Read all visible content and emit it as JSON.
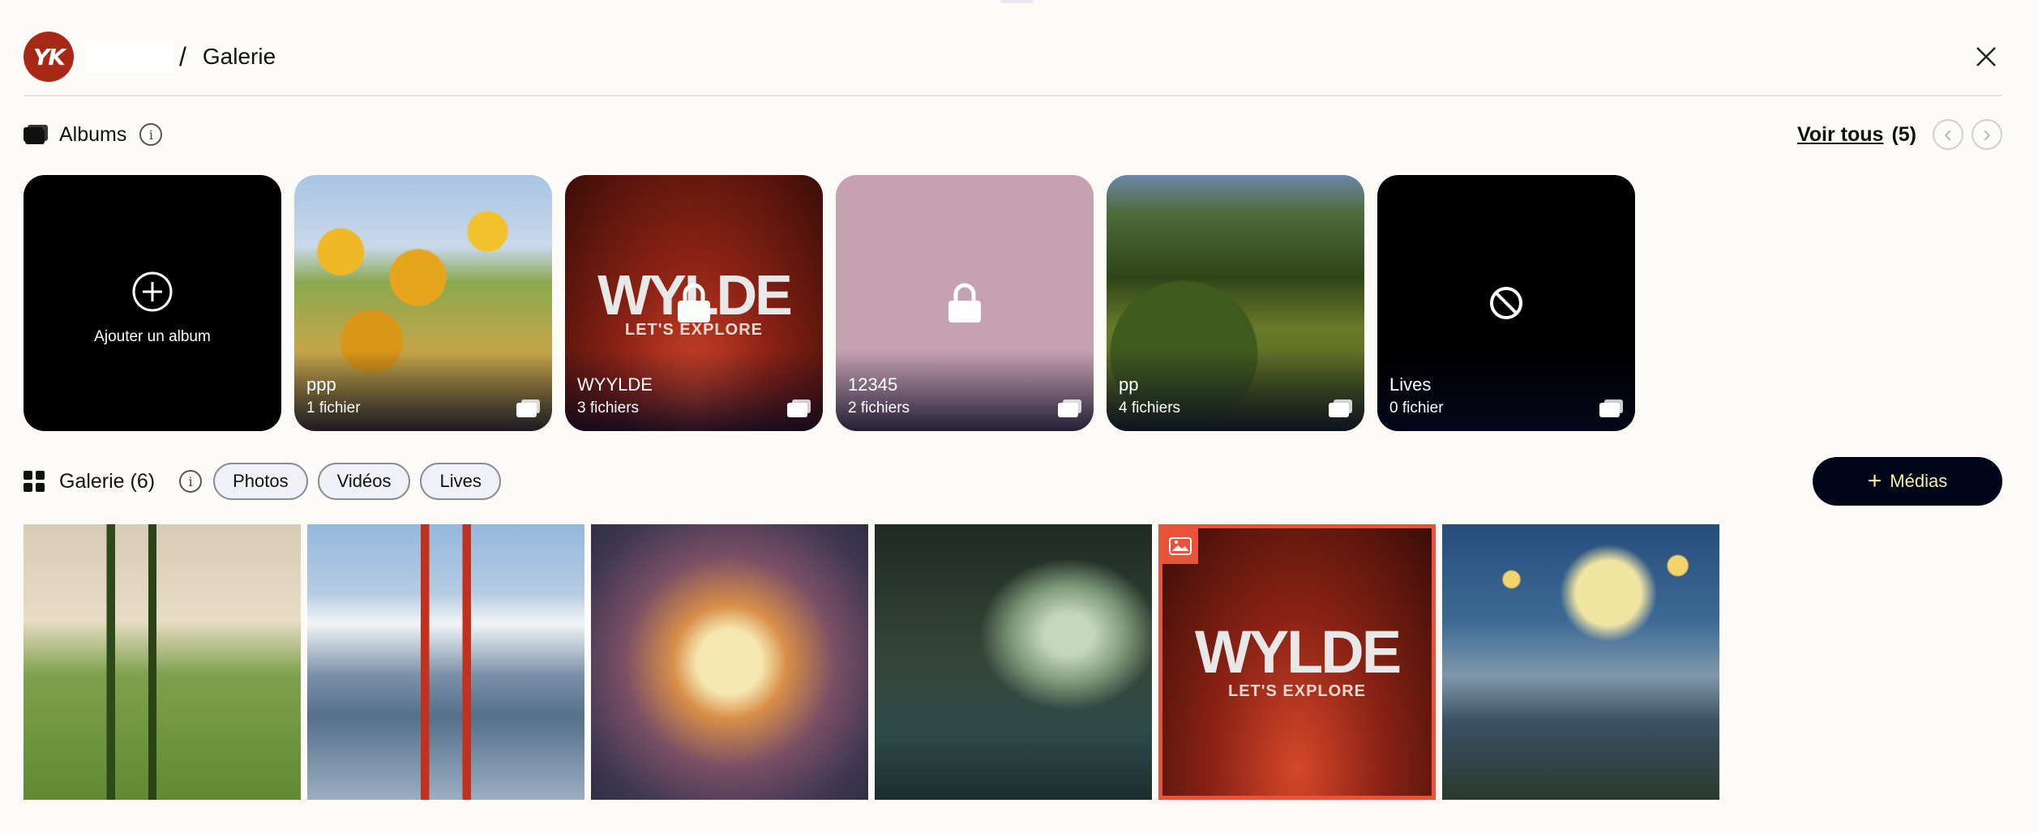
{
  "breadcrumb": {
    "separator": "/",
    "title": "Galerie"
  },
  "logo": {
    "text": "YK"
  },
  "albums_section": {
    "title": "Albums",
    "info": "i",
    "see_all_label": "Voir tous",
    "see_all_count": "(5)",
    "prev": "‹",
    "next": "›"
  },
  "albums": [
    {
      "label": "Ajouter un album"
    },
    {
      "name": "ppp",
      "count": "1 fichier"
    },
    {
      "name": "WYYLDE",
      "count": "3 fichiers",
      "word": "WYLDE",
      "sub": "LET'S EXPLORE"
    },
    {
      "name": "12345",
      "count": "2 fichiers"
    },
    {
      "name": "pp",
      "count": "4 fichiers"
    },
    {
      "name": "Lives",
      "count": "0 fichier"
    }
  ],
  "gallery_section": {
    "title": "Galerie (6)",
    "info": "i",
    "filters": [
      "Photos",
      "Vidéos",
      "Lives"
    ],
    "add_button": {
      "plus": "+",
      "label": "Médias"
    }
  },
  "gallery_featured": {
    "word": "WYLDE",
    "sub": "LET'S EXPLORE"
  },
  "colors": {
    "accent": "#e8533a",
    "button_bg": "#020519",
    "button_text": "#f4f0a0",
    "logo_bg": "#a82816"
  }
}
